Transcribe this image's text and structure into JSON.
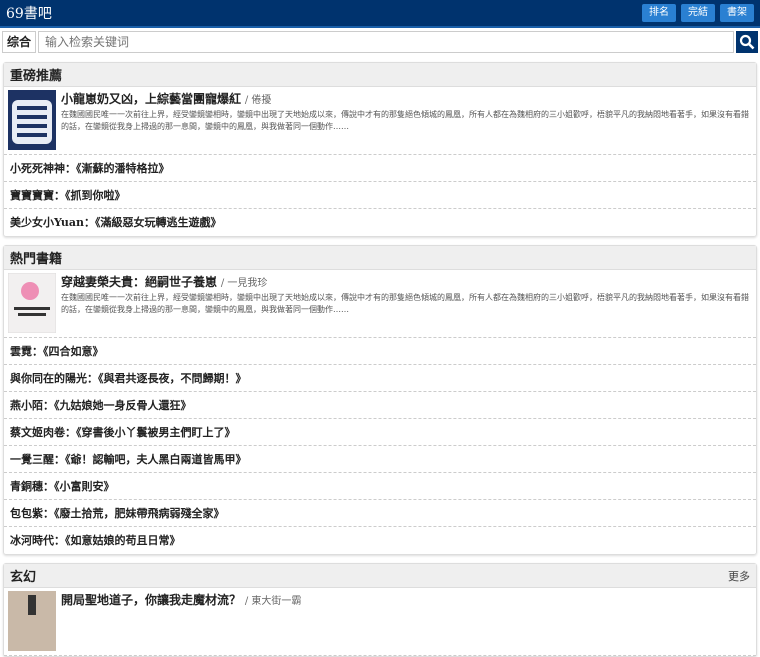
{
  "header": {
    "logo": "69書吧",
    "buttons": [
      "排名",
      "完結",
      "書架"
    ]
  },
  "search": {
    "category": "综合",
    "placeholder": "输入检索关键词"
  },
  "colors": {
    "header": "#00336e",
    "button": "#2a80d2"
  },
  "sections": [
    {
      "title": "重磅推薦",
      "more": "",
      "book": {
        "title": "小龍崽奶又凶，上綜藝當團寵爆紅",
        "author": "/ 倦擾",
        "desc": "在魏國國民唯一一次前往上界，經受鑾鏡鑾相時，鑾鏡中出現了天地始成以來，傳說中才有的那隻絕色傾城的鳳凰，所有人都在為魏相府的三小姐歡呼，梧貌平凡的我納悶地看著手，如果沒有看錯的話，在鑾鏡從我身上掃過的那一息間，鑾鏡中的鳳凰，與我做著同一個動作……"
      },
      "items": [
        "小死死神神：《漸蘇的潘特格拉》",
        "寶寶寶寶：《抓到你啦》",
        "美少女小Yuan：《滿級惡女玩轉逃生遊戲》"
      ]
    },
    {
      "title": "熱門書籍",
      "more": "",
      "book": {
        "title": "穿越妻榮夫貴：絕嗣世子養崽",
        "author": "/ 一見我珍",
        "desc": "在魏國國民唯一一次前往上界，經受鑾鏡鑾相時，鑾鏡中出現了天地始成以來，傳說中才有的那隻絕色傾城的鳳凰，所有人都在為魏相府的三小姐歡呼，梧貌平凡的我納悶地看著手，如果沒有看錯的話，在鑾鏡從我身上掃過的那一息間，鑾鏡中的鳳凰，與我做著同一個動作……"
      },
      "items": [
        "雲霓：《四合如意》",
        "與你同在的陽光：《與君共逐長夜，不問歸期！》",
        "燕小陌：《九姑娘她一身反骨人還狂》",
        "蔡文姬肉卷：《穿書後小丫鬟被男主們盯上了》",
        "一覺三醒：《爺！認輸吧，夫人黑白兩道皆馬甲》",
        "青銅穗：《小富則安》",
        "包包紫：《廢土拾荒，肥妹帶飛病弱殘全家》",
        "冰河時代：《如意姑娘的苟且日常》"
      ]
    },
    {
      "title": "玄幻",
      "more": "更多",
      "book": {
        "title": "開局聖地道子，你讓我走魔材流？",
        "author": "/ 東大街一霸",
        "desc": ""
      },
      "items": []
    }
  ]
}
